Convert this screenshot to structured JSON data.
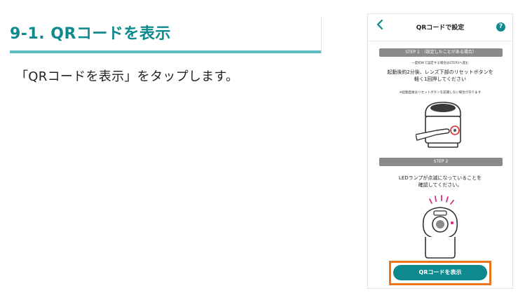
{
  "article": {
    "heading": "9-1. QRコードを表示",
    "instruction": "「QRコードを表示」をタップします。"
  },
  "phone": {
    "back_icon": "chevron-left-icon",
    "title": "QRコードで設定",
    "help_label": "?",
    "step1": {
      "label": "STEP 1　（設定したことがある場合）",
      "note": "一度初めて設定する場合はSTEP2へ進む",
      "text_line1": "起動後約2分後、レンズ下部のリセットボタンを",
      "text_line2": "軽く1回押してください",
      "subnote": "※起動直後はリセットボタンを認識しない場合があります"
    },
    "step2": {
      "label": "STEP 2",
      "text_line1": "LEDランプが点滅になっていることを",
      "text_line2": "確認してください。"
    },
    "qr_button_label": "QRコードを表示",
    "colors": {
      "accent": "#0e8a8e",
      "highlight": "#e8761e",
      "step_bar": "#8a8a8a",
      "led": "#e0288a"
    }
  }
}
